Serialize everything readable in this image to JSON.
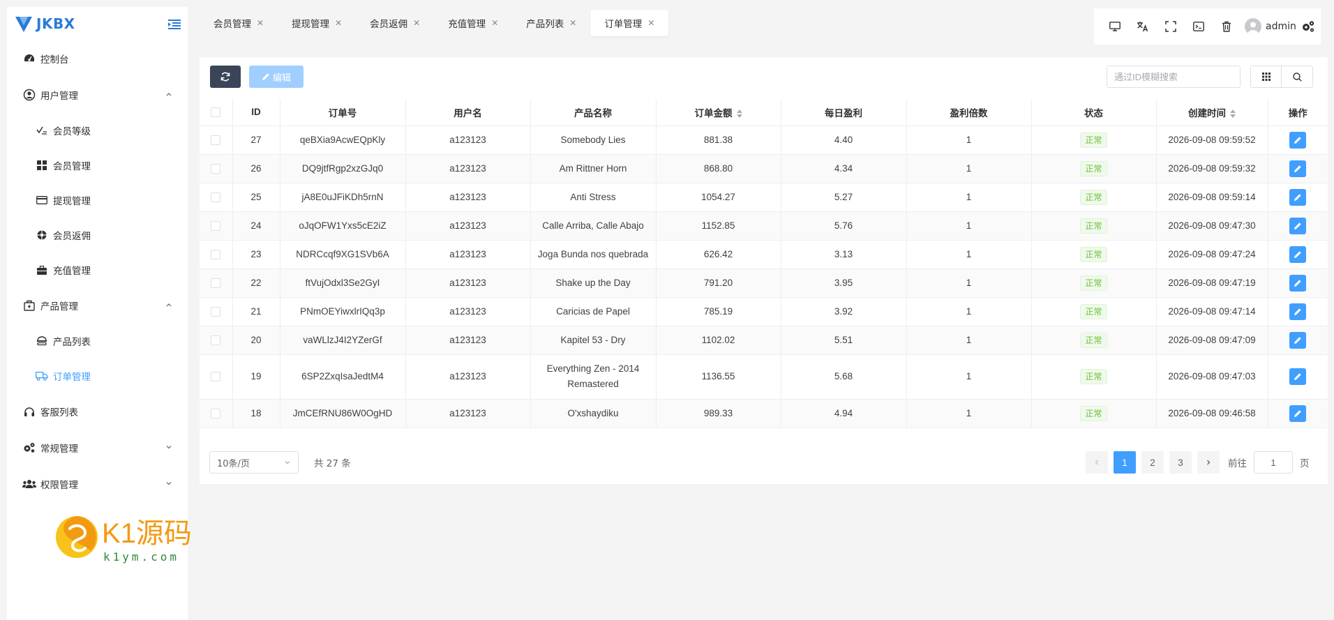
{
  "app": {
    "title": "JKBX"
  },
  "sidebar": {
    "items": [
      {
        "label": "控制台",
        "icon": "dashboard-icon"
      },
      {
        "label": "用户管理",
        "icon": "user-icon",
        "expanded": true,
        "children": [
          {
            "label": "会员等级",
            "icon": "level-icon"
          },
          {
            "label": "会员管理",
            "icon": "grid-icon"
          },
          {
            "label": "提现管理",
            "icon": "card-icon"
          },
          {
            "label": "会员返佣",
            "icon": "commission-icon"
          },
          {
            "label": "充值管理",
            "icon": "briefcase-icon"
          }
        ]
      },
      {
        "label": "产品管理",
        "icon": "box-icon",
        "expanded": true,
        "children": [
          {
            "label": "产品列表",
            "icon": "product-icon"
          },
          {
            "label": "订单管理",
            "icon": "truck-icon",
            "active": true
          }
        ]
      },
      {
        "label": "客服列表",
        "icon": "headset-icon"
      },
      {
        "label": "常规管理",
        "icon": "gears-icon",
        "expanded": false
      },
      {
        "label": "权限管理",
        "icon": "users-icon",
        "expanded": false
      }
    ]
  },
  "tabs": [
    {
      "label": "会员管理"
    },
    {
      "label": "提现管理"
    },
    {
      "label": "会员返佣"
    },
    {
      "label": "充值管理"
    },
    {
      "label": "产品列表"
    },
    {
      "label": "订单管理",
      "active": true
    }
  ],
  "header": {
    "user": "admin"
  },
  "toolbar": {
    "edit_label": "编辑",
    "search_placeholder": "通过ID模糊搜索"
  },
  "table": {
    "columns": [
      "ID",
      "订单号",
      "用户名",
      "产品名称",
      "订单金额",
      "每日盈利",
      "盈利倍数",
      "状态",
      "创建时间",
      "操作"
    ],
    "rows": [
      {
        "id": "27",
        "order_no": "qeBXia9AcwEQpKly",
        "username": "a123123",
        "product": "Somebody Lies",
        "amount": "881.38",
        "daily_profit": "4.40",
        "multiple": "1",
        "status": "正常",
        "created": "2026-09-08 09:59:52"
      },
      {
        "id": "26",
        "order_no": "DQ9jtfRgp2xzGJq0",
        "username": "a123123",
        "product": "Am Rittner Horn",
        "amount": "868.80",
        "daily_profit": "4.34",
        "multiple": "1",
        "status": "正常",
        "created": "2026-09-08 09:59:32"
      },
      {
        "id": "25",
        "order_no": "jA8E0uJFiKDh5rnN",
        "username": "a123123",
        "product": "Anti Stress",
        "amount": "1054.27",
        "daily_profit": "5.27",
        "multiple": "1",
        "status": "正常",
        "created": "2026-09-08 09:59:14"
      },
      {
        "id": "24",
        "order_no": "oJqOFW1Yxs5cE2iZ",
        "username": "a123123",
        "product": "Calle Arriba, Calle Abajo",
        "amount": "1152.85",
        "daily_profit": "5.76",
        "multiple": "1",
        "status": "正常",
        "created": "2026-09-08 09:47:30"
      },
      {
        "id": "23",
        "order_no": "NDRCcqf9XG1SVb6A",
        "username": "a123123",
        "product": "Joga Bunda nos quebrada",
        "amount": "626.42",
        "daily_profit": "3.13",
        "multiple": "1",
        "status": "正常",
        "created": "2026-09-08 09:47:24"
      },
      {
        "id": "22",
        "order_no": "ftVujOdxl3Se2GyI",
        "username": "a123123",
        "product": "Shake up the Day",
        "amount": "791.20",
        "daily_profit": "3.95",
        "multiple": "1",
        "status": "正常",
        "created": "2026-09-08 09:47:19"
      },
      {
        "id": "21",
        "order_no": "PNmOEYiwxlrIQq3p",
        "username": "a123123",
        "product": "Caricias de Papel",
        "amount": "785.19",
        "daily_profit": "3.92",
        "multiple": "1",
        "status": "正常",
        "created": "2026-09-08 09:47:14"
      },
      {
        "id": "20",
        "order_no": "vaWLlzJ4I2YZerGf",
        "username": "a123123",
        "product": "Kapitel 53 - Dry",
        "amount": "1102.02",
        "daily_profit": "5.51",
        "multiple": "1",
        "status": "正常",
        "created": "2026-09-08 09:47:09"
      },
      {
        "id": "19",
        "order_no": "6SP2ZxqIsaJedtM4",
        "username": "a123123",
        "product": "Everything Zen - 2014 Remastered",
        "amount": "1136.55",
        "daily_profit": "5.68",
        "multiple": "1",
        "status": "正常",
        "created": "2026-09-08 09:47:03"
      },
      {
        "id": "18",
        "order_no": "JmCEfRNU86W0OgHD",
        "username": "a123123",
        "product": "O'xshaydiku",
        "amount": "989.33",
        "daily_profit": "4.94",
        "multiple": "1",
        "status": "正常",
        "created": "2026-09-08 09:46:58"
      }
    ]
  },
  "pagination": {
    "page_size": "10条/页",
    "total": "共 27 条",
    "pages": [
      "1",
      "2",
      "3"
    ],
    "current": "1",
    "goto_prefix": "前往",
    "goto_value": "1",
    "goto_suffix": "页"
  },
  "watermark": {
    "brand": "K1源码",
    "url": "k1ym.com"
  },
  "colors": {
    "primary": "#409eff",
    "dark": "#3a4658",
    "success": "#67c23a",
    "logo": "#2a7bd8"
  }
}
